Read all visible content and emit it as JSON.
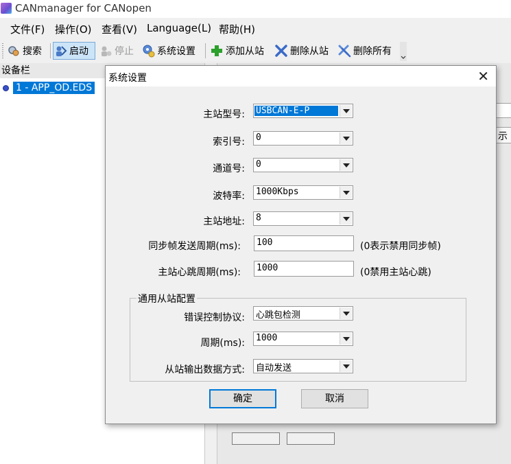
{
  "app": {
    "title": "CANmanager for CANopen"
  },
  "menu": [
    {
      "label": "文件(F)"
    },
    {
      "label": "操作(O)"
    },
    {
      "label": "查看(V)"
    },
    {
      "label": "Language(L)"
    },
    {
      "label": "帮助(H)"
    }
  ],
  "toolbar": {
    "search_label": "搜索",
    "start_label": "启动",
    "stop_label": "停止",
    "settings_label": "系统设置",
    "add_slave_label": "添加从站",
    "delete_slave_label": "删除从站",
    "delete_all_label": "删除所有"
  },
  "device_pane": {
    "header": "设备栏",
    "items": [
      {
        "label": "1 - APP_OD.EDS"
      }
    ]
  },
  "right_pane": {
    "partial_text": "示"
  },
  "dialog": {
    "title": "系统设置",
    "master_model": {
      "label": "主站型号:",
      "value": "USBCAN-E-P"
    },
    "index": {
      "label": "索引号:",
      "value": "0"
    },
    "channel": {
      "label": "通道号:",
      "value": "0"
    },
    "baud_rate": {
      "label": "波特率:",
      "value": "1000Kbps"
    },
    "master_address": {
      "label": "主站地址:",
      "value": "8"
    },
    "sync_period": {
      "label": "同步帧发送周期(ms):",
      "value": "100",
      "hint": "(0表示禁用同步帧)"
    },
    "heartbeat_period": {
      "label": "主站心跳周期(ms):",
      "value": "1000",
      "hint": "(0禁用主站心跳)"
    },
    "general_slave": {
      "title": "通用从站配置",
      "error_control": {
        "label": "错误控制协议:",
        "value": "心跳包检测"
      },
      "period": {
        "label": "周期(ms):",
        "value": "1000"
      },
      "output_mode": {
        "label": "从站输出数据方式:",
        "value": "自动发送"
      }
    },
    "ok_label": "确定",
    "cancel_label": "取消"
  },
  "colors": {
    "selection": "#0078d7",
    "toolbar_active": "#cce4f7"
  }
}
